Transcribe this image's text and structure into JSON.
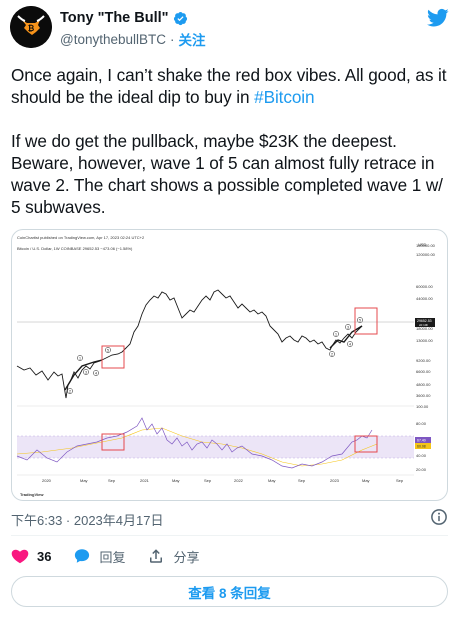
{
  "author": {
    "name": "Tony \"The Bull\"",
    "handle": "@tonythebullBTC",
    "follow_label": "关注"
  },
  "tweet": {
    "line1_text": "Once again, I can’t shake the red box vibes. All good, as it should be the ideal dip to buy in ",
    "hashtag": "#Bitcoin",
    "paragraph2": "If we do get the pullback, maybe $23K the deepest. Beware, however, wave 1 of 5 can almost fully retrace in wave 2. The chart shows a possible completed wave 1 w/ 5 subwaves."
  },
  "chart": {
    "header_line": "CoinChartist published on TradingView.com, Apr 17, 2023 02:24 UTC+2",
    "symbol_line": "Bitcoin / U.S. Dollar, 1W COINBASE  29652.53  −473.06 (−1.58%)",
    "currency": "USD",
    "price_ticks": [
      "160000.00",
      "120000.00",
      "60000.00",
      "44000.00",
      "18000.00",
      "13000.00",
      "9200.00",
      "6600.00",
      "4800.00",
      "3600.00"
    ],
    "current_price": "29652.53",
    "current_price_sub": "2d 10h",
    "rsi_ticks": [
      "100.00",
      "80.00",
      "60.00",
      "40.00",
      "20.00"
    ],
    "rsi_current": "67.40",
    "rsi_ma": "60.08",
    "x_labels": [
      "2020",
      "May",
      "Sep",
      "2021",
      "May",
      "Sep",
      "2022",
      "May",
      "Sep",
      "2023",
      "May",
      "Sep"
    ],
    "wave_labels_early": [
      "1",
      "2",
      "3",
      "4",
      "5"
    ],
    "wave_labels_recent": [
      "1",
      "2",
      "3",
      "4",
      "5"
    ],
    "watermark": "TradingView",
    "colors": {
      "price_line": "#1a1a1a",
      "red_box": "#e5484d",
      "rsi_line": "#7e57c2",
      "rsi_band": "#ece5f7",
      "rsi_ma": "#f5c518"
    }
  },
  "meta": {
    "timestamp": "下午6:33 · 2023年4月17日"
  },
  "actions": {
    "like_count": "36",
    "reply_label": "回复",
    "share_label": "分享"
  },
  "replies_button": "查看 8 条回复",
  "icons": {
    "verified": "verified-badge-icon",
    "twitter": "twitter-bird-icon",
    "info": "info-icon",
    "like": "heart-icon",
    "reply": "reply-bubble-icon",
    "share": "share-upload-icon"
  }
}
